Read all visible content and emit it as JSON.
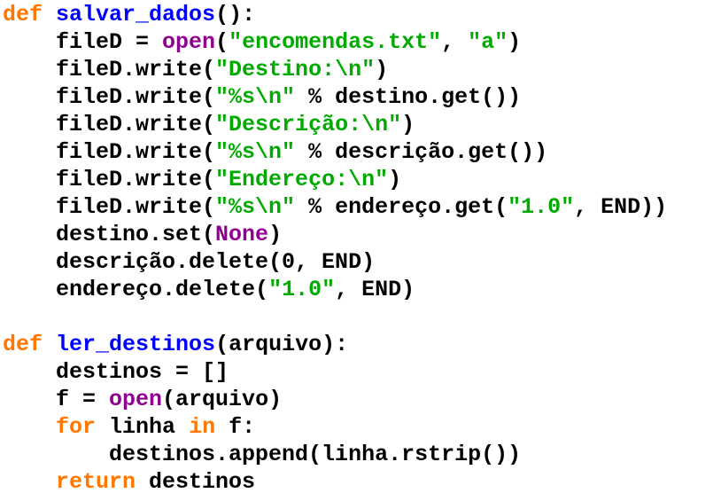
{
  "colors": {
    "keyword": "#ff7700",
    "function_name": "#0000ff",
    "builtin": "#900090",
    "string": "#00aa00",
    "default": "#000000",
    "background": "#ffffff"
  },
  "editor": {
    "lines": [
      [
        {
          "t": "def",
          "k": "keyword"
        },
        {
          "t": " ",
          "k": "plain"
        },
        {
          "t": "salvar_dados",
          "k": "funcname"
        },
        {
          "t": "():",
          "k": "plain"
        }
      ],
      [
        {
          "t": "    fileD = ",
          "k": "plain"
        },
        {
          "t": "open",
          "k": "builtin"
        },
        {
          "t": "(",
          "k": "plain"
        },
        {
          "t": "\"encomendas.txt\"",
          "k": "string"
        },
        {
          "t": ", ",
          "k": "plain"
        },
        {
          "t": "\"a\"",
          "k": "string"
        },
        {
          "t": ")",
          "k": "plain"
        }
      ],
      [
        {
          "t": "    fileD.write(",
          "k": "plain"
        },
        {
          "t": "\"Destino:\\n\"",
          "k": "string"
        },
        {
          "t": ")",
          "k": "plain"
        }
      ],
      [
        {
          "t": "    fileD.write(",
          "k": "plain"
        },
        {
          "t": "\"%s\\n\"",
          "k": "string"
        },
        {
          "t": " % destino.get())",
          "k": "plain"
        }
      ],
      [
        {
          "t": "    fileD.write(",
          "k": "plain"
        },
        {
          "t": "\"Descrição:\\n\"",
          "k": "string"
        },
        {
          "t": ")",
          "k": "plain"
        }
      ],
      [
        {
          "t": "    fileD.write(",
          "k": "plain"
        },
        {
          "t": "\"%s\\n\"",
          "k": "string"
        },
        {
          "t": " % descrição.get())",
          "k": "plain"
        }
      ],
      [
        {
          "t": "    fileD.write(",
          "k": "plain"
        },
        {
          "t": "\"Endereço:\\n\"",
          "k": "string"
        },
        {
          "t": ")",
          "k": "plain"
        }
      ],
      [
        {
          "t": "    fileD.write(",
          "k": "plain"
        },
        {
          "t": "\"%s\\n\"",
          "k": "string"
        },
        {
          "t": " % endereço.get(",
          "k": "plain"
        },
        {
          "t": "\"1.0\"",
          "k": "string"
        },
        {
          "t": ", END))",
          "k": "plain"
        }
      ],
      [
        {
          "t": "    destino.set(",
          "k": "plain"
        },
        {
          "t": "None",
          "k": "builtin"
        },
        {
          "t": ")",
          "k": "plain"
        }
      ],
      [
        {
          "t": "    descrição.delete(0, END)",
          "k": "plain"
        }
      ],
      [
        {
          "t": "    endereço.delete(",
          "k": "plain"
        },
        {
          "t": "\"1.0\"",
          "k": "string"
        },
        {
          "t": ", END)",
          "k": "plain"
        }
      ],
      [],
      [
        {
          "t": "def",
          "k": "keyword"
        },
        {
          "t": " ",
          "k": "plain"
        },
        {
          "t": "ler_destinos",
          "k": "funcname"
        },
        {
          "t": "(arquivo):",
          "k": "plain"
        }
      ],
      [
        {
          "t": "    destinos = []",
          "k": "plain"
        }
      ],
      [
        {
          "t": "    f = ",
          "k": "plain"
        },
        {
          "t": "open",
          "k": "builtin"
        },
        {
          "t": "(arquivo)",
          "k": "plain"
        }
      ],
      [
        {
          "t": "    ",
          "k": "plain"
        },
        {
          "t": "for",
          "k": "keyword"
        },
        {
          "t": " linha ",
          "k": "plain"
        },
        {
          "t": "in",
          "k": "keyword"
        },
        {
          "t": " f:",
          "k": "plain"
        }
      ],
      [
        {
          "t": "        destinos.append(linha.rstrip())",
          "k": "plain"
        }
      ],
      [
        {
          "t": "    ",
          "k": "plain"
        },
        {
          "t": "return",
          "k": "keyword"
        },
        {
          "t": " destinos",
          "k": "plain"
        }
      ]
    ]
  }
}
